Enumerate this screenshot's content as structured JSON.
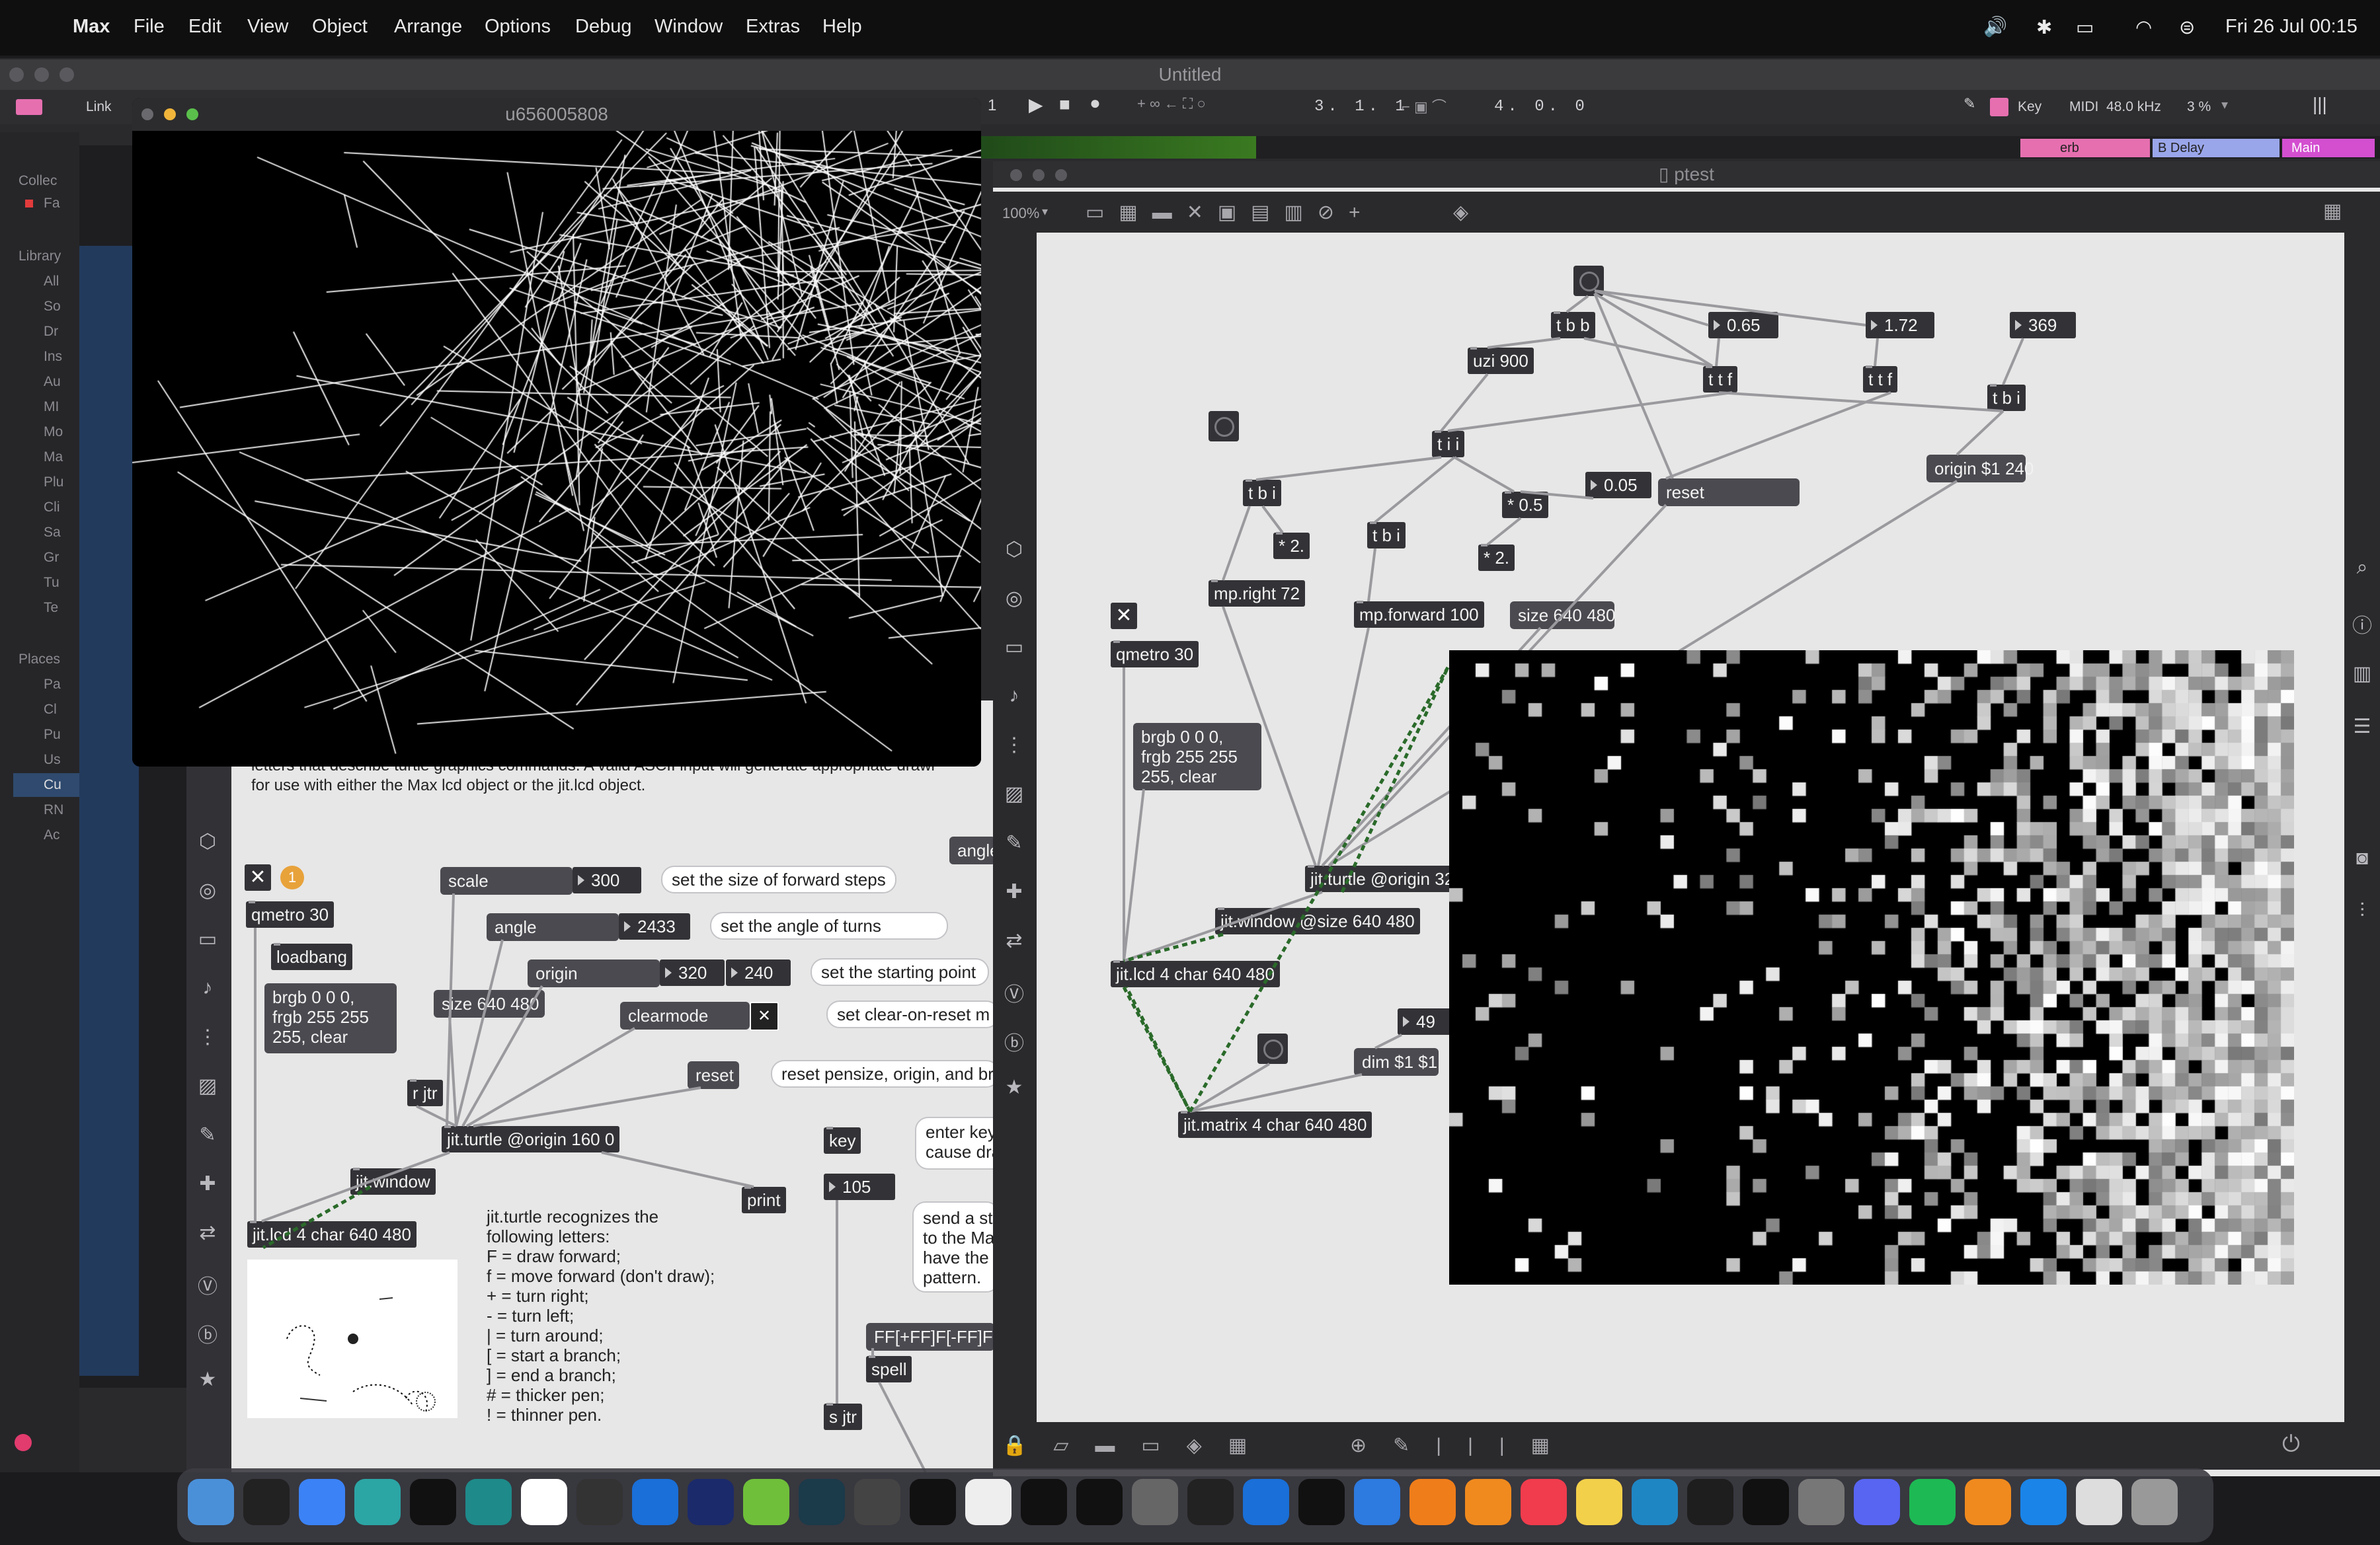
{
  "menubar": {
    "app": "Max",
    "items": [
      "File",
      "Edit",
      "View",
      "Object",
      "Arrange",
      "Options",
      "Debug",
      "Window",
      "Extras",
      "Help"
    ],
    "clock": "Fri 26 Jul  00:15"
  },
  "max_window": {
    "title": "Untitled",
    "link_label": "Link",
    "transport": {
      "bar_counter": "1",
      "position": "3. 1. 1",
      "time_sig": "4. 0. 0",
      "key_label": "Key",
      "midi_label": "MIDI",
      "sample_rate": "48.0 kHz",
      "cpu": "3 %"
    },
    "tracks": [
      "erb",
      "B Delay",
      "Main"
    ],
    "sidebar": {
      "collections_label": "Collec",
      "fav_label": "Fa",
      "library_label": "Library",
      "library_items": [
        "All",
        "So",
        "Dr",
        "Ins",
        "Au",
        "MI",
        "Mo",
        "Ma",
        "Plu",
        "Cli",
        "Sa",
        "Gr",
        "Tu",
        "Te"
      ],
      "places_label": "Places",
      "places_items": [
        "Pa",
        "Cl",
        "Pu",
        "Us",
        "Cu",
        "RN",
        "Ac"
      ]
    }
  },
  "turtle_window": {
    "title": "u656005808"
  },
  "help_patch": {
    "intro_text": [
      "letters that describe turtle graphics commands. A valid ASCII input will generate appropriate drawi",
      "for use with either the Max lcd object or the jit.lcd object."
    ],
    "badge": "1",
    "qmetro": "qmetro 30",
    "loadbang": "loadbang",
    "brgb_msg": "brgb 0 0 0,\nfrgb 255 255\n255, clear",
    "scale_msg": "scale",
    "scale_num": "300",
    "scale_comment": "set the size of forward steps",
    "angle_msg": "angle",
    "angle_num": "2433",
    "angle_comment": "set the angle of turns",
    "angle_right": "angle",
    "origin_msg": "origin",
    "origin_x": "320",
    "origin_y": "240",
    "origin_comment": "set the starting point",
    "size_msg": "size 640 480",
    "clearmode_msg": "clearmode",
    "clearmode_comment": "set clear-on-reset m",
    "reset_msg": "reset",
    "reset_comment": "reset pensize, origin, and br",
    "r_jtr": "r jtr",
    "turtle_obj": "jit.turtle @origin 160 0",
    "window_obj": "jit.window",
    "print_obj": "print",
    "lcd_obj": "jit.lcd 4 char 640 480",
    "key_obj": "key",
    "key_comment": "enter key\ncause dra",
    "key_num": "105",
    "send_comment": "send a st\nto the Ma\nhave the\npattern.",
    "lsystem_msg": "FF[+FF]F[-FF]F",
    "spell_obj": "spell",
    "s_jtr": "s jtr",
    "letters_text": "jit.turtle recognizes the\nfollowing letters:\nF = draw forward;\nf = move forward (don't draw);\n+ = turn right;\n- = turn left;\n| = turn around;\n[ = start a branch;\n] = end a branch;\n# = thicker pen;\n! = thinner pen."
  },
  "ptest": {
    "title": "ptest",
    "zoom": "100%",
    "objects": {
      "tbb": "t b b",
      "num_065": "0.65",
      "num_172": "1.72",
      "num_369": "369",
      "uzi": "uzi 900",
      "ttf1": "t t f",
      "ttf2": "t t f",
      "tbi_top": "t b i",
      "tii": "t i i",
      "tbi_left": "t b i",
      "mul_05": "* 0.5",
      "num_005": "0.05",
      "reset": "reset",
      "origin_msg": "origin $1 240",
      "mul_2a": "* 2.",
      "tbi_mid": "t b i",
      "mul_2b": "* 2.",
      "mp_right": "mp.right 72",
      "mp_forward": "mp.forward 100",
      "size_msg": "size 640 480",
      "qmetro": "qmetro 30",
      "brgb_msg": "brgb 0 0 0,\nfrgb 255 255\n255, clear",
      "turtle": "jit.turtle @origin 32",
      "window": "jit.window @size 640 480",
      "lcd": "jit.lcd 4 char 640 480",
      "num_49": "49",
      "dim_msg": "dim $1 $1",
      "matrix": "jit.matrix 4 char 640 480"
    }
  },
  "dock": {
    "apps": [
      "Finder",
      "Terminal",
      "Xcode",
      "Shortcuts",
      "OBS",
      "Arduino",
      "Pd",
      "DaVinci",
      "Keynote",
      "Sequencer",
      "Android Studio",
      "Logic",
      "Audacity",
      "Max",
      "Launchpad",
      "Max 8",
      "Live",
      "Cable",
      "Piano",
      "Bird",
      "Utility",
      "Remote",
      "Blender",
      "VLC",
      "Music",
      "Notes",
      "Monitor",
      "Console",
      "WARNER",
      "Calculator",
      "Discord",
      "Spotify",
      "Books",
      "Safari",
      "Files",
      "Trash"
    ]
  },
  "colors": {
    "accent_orange": "#e8a23a",
    "patch_bg": "#e7e7e7",
    "object_bg": "#333337",
    "track_pink": "#e66fb0",
    "track_lavender": "#9aa6ea",
    "track_magenta": "#d34fd0"
  }
}
